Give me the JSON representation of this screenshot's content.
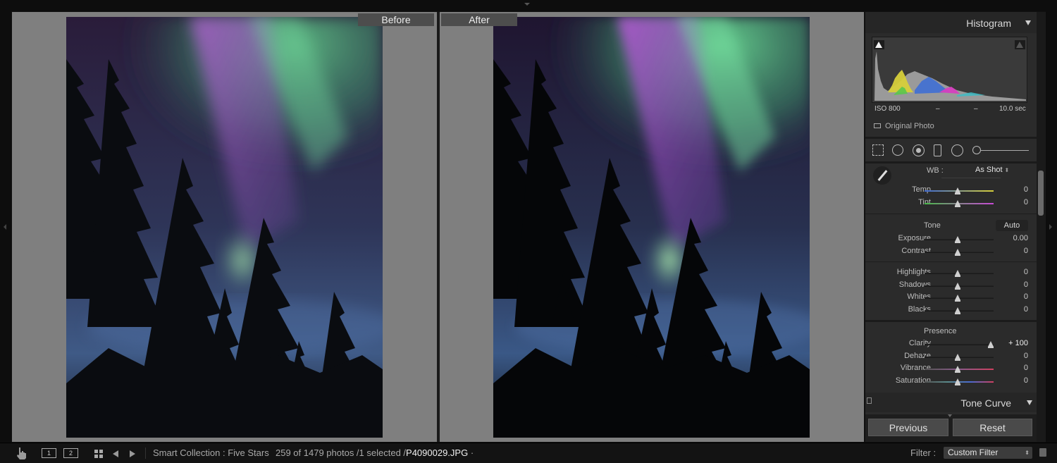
{
  "compare": {
    "before_label": "Before",
    "after_label": "After"
  },
  "histogram": {
    "title": "Histogram",
    "iso": "ISO 800",
    "dash1": "–",
    "dash2": "–",
    "shutter": "10.0 sec",
    "original_photo_label": "Original Photo"
  },
  "tools": [
    "crop-overlay",
    "spot-removal",
    "red-eye",
    "graduated-filter",
    "radial-filter",
    "adjustment-brush"
  ],
  "basic": {
    "wb_label": "WB :",
    "wb_value": "As Shot",
    "wb_updown": "⬍",
    "temp": {
      "label": "Temp",
      "value": "0",
      "position": 0.5
    },
    "tint": {
      "label": "Tint",
      "value": "0",
      "position": 0.5
    },
    "tone_title": "Tone",
    "auto_label": "Auto",
    "exposure": {
      "label": "Exposure",
      "value": "0.00",
      "position": 0.5
    },
    "contrast": {
      "label": "Contrast",
      "value": "0",
      "position": 0.5
    },
    "highlights": {
      "label": "Highlights",
      "value": "0",
      "position": 0.5
    },
    "shadows": {
      "label": "Shadows",
      "value": "0",
      "position": 0.5
    },
    "whites": {
      "label": "Whites",
      "value": "0",
      "position": 0.5
    },
    "blacks": {
      "label": "Blacks",
      "value": "0",
      "position": 0.5
    },
    "presence_title": "Presence",
    "clarity": {
      "label": "Clarity",
      "value": "+ 100",
      "position": 1.0
    },
    "dehaze": {
      "label": "Dehaze",
      "value": "0",
      "position": 0.5
    },
    "vibrance": {
      "label": "Vibrance",
      "value": "0",
      "position": 0.5
    },
    "saturation": {
      "label": "Saturation",
      "value": "0",
      "position": 0.5
    }
  },
  "tone_curve": {
    "title": "Tone Curve"
  },
  "buttons": {
    "previous": "Previous",
    "reset": "Reset"
  },
  "toolbar": {
    "monitor_1": "1",
    "monitor_2": "2",
    "collection": "Smart Collection : Five Stars",
    "count": "259 of 1479 photos /1 selected /",
    "filename": "P4090029.JPG",
    "filename_suffix": " ·",
    "filter_label": "Filter :",
    "filter_value": "Custom Filter",
    "filter_updown": "⬍"
  },
  "colors": {
    "panel_bg": "#2b2b2b",
    "pane_bg": "#7f7f7f",
    "aurora_green": "#5fc88a",
    "aurora_purple": "#a15bc7",
    "sky_blue": "#4a6a9a"
  }
}
